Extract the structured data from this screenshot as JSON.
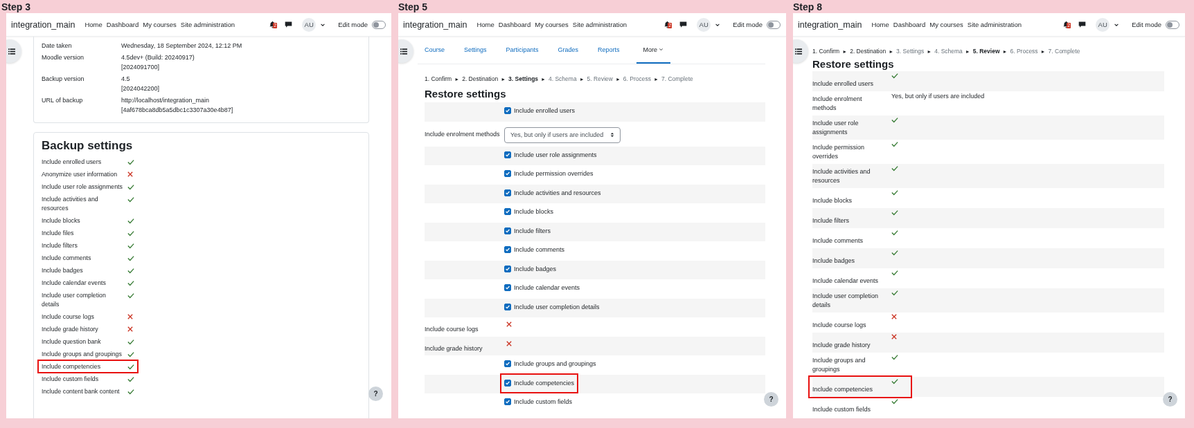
{
  "panels": [
    {
      "step": "Step 3",
      "kind": "backup",
      "site": "integration_main",
      "nav": [
        "Home",
        "Dashboard",
        "My courses",
        "Site administration"
      ],
      "notifications": "2",
      "avatar": "AU",
      "edit_mode_label": "Edit mode",
      "edit_mode": false,
      "help": "?",
      "details": [
        {
          "label": "Date taken",
          "value": [
            "Wednesday, 18 September 2024, 12:12 PM"
          ]
        },
        {
          "label": "Moodle version",
          "value": [
            "4.5dev+ (Build: 20240917)",
            "[2024091700]"
          ]
        },
        {
          "label": "Backup version",
          "value": [
            "4.5",
            "[2024042200]"
          ]
        },
        {
          "label": "URL of backup",
          "value": [
            "http://localhost/integration_main",
            "[4af678bca8db5a5dbc1c3307a30e4b87]"
          ]
        }
      ],
      "title": "Backup settings",
      "rows": [
        {
          "kind": "status",
          "label": "Include enrolled users",
          "included": true,
          "highlighted": false
        },
        {
          "kind": "status",
          "label": "Anonymize user information",
          "included": false,
          "highlighted": false
        },
        {
          "kind": "status",
          "label": "Include user role assignments",
          "included": true,
          "highlighted": false
        },
        {
          "kind": "status",
          "label": "Include activities and resources",
          "included": true,
          "highlighted": false
        },
        {
          "kind": "status",
          "label": "Include blocks",
          "included": true,
          "highlighted": false
        },
        {
          "kind": "status",
          "label": "Include files",
          "included": true,
          "highlighted": false
        },
        {
          "kind": "status",
          "label": "Include filters",
          "included": true,
          "highlighted": false
        },
        {
          "kind": "status",
          "label": "Include comments",
          "included": true,
          "highlighted": false
        },
        {
          "kind": "status",
          "label": "Include badges",
          "included": true,
          "highlighted": false
        },
        {
          "kind": "status",
          "label": "Include calendar events",
          "included": true,
          "highlighted": false
        },
        {
          "kind": "status",
          "label": "Include user completion details",
          "included": true,
          "highlighted": false
        },
        {
          "kind": "status",
          "label": "Include course logs",
          "included": false,
          "highlighted": false
        },
        {
          "kind": "status",
          "label": "Include grade history",
          "included": false,
          "highlighted": false
        },
        {
          "kind": "status",
          "label": "Include question bank",
          "included": true,
          "highlighted": false
        },
        {
          "kind": "status",
          "label": "Include groups and groupings",
          "included": true,
          "highlighted": false
        },
        {
          "kind": "status",
          "label": "Include competencies",
          "included": true,
          "highlighted": true
        },
        {
          "kind": "status",
          "label": "Include custom fields",
          "included": true,
          "highlighted": false
        },
        {
          "kind": "status",
          "label": "Include content bank content",
          "included": true,
          "highlighted": false
        }
      ]
    },
    {
      "step": "Step 5",
      "kind": "restore",
      "site": "integration_main",
      "nav": [
        "Home",
        "Dashboard",
        "My courses",
        "Site administration"
      ],
      "notifications": "2",
      "avatar": "AU",
      "edit_mode_label": "Edit mode",
      "edit_mode": false,
      "help": "?",
      "tabs": [
        {
          "label": "Course",
          "selected": false
        },
        {
          "label": "Settings",
          "selected": false
        },
        {
          "label": "Participants",
          "selected": false
        },
        {
          "label": "Grades",
          "selected": false
        },
        {
          "label": "Reports",
          "selected": false
        },
        {
          "label": "More",
          "selected": true
        }
      ],
      "steps": {
        "separator": "►",
        "items": [
          {
            "label": "1. Confirm",
            "current": false,
            "disabled": false
          },
          {
            "label": "2. Destination",
            "current": false,
            "disabled": false
          },
          {
            "label": "3. Settings",
            "current": true,
            "disabled": false
          },
          {
            "label": "4. Schema",
            "current": false,
            "disabled": true
          },
          {
            "label": "5. Review",
            "current": false,
            "disabled": true
          },
          {
            "label": "6. Process",
            "current": false,
            "disabled": true
          },
          {
            "label": "7. Complete",
            "current": false,
            "disabled": true
          }
        ]
      },
      "title": "Restore settings",
      "rows": [
        {
          "kind": "checkbox",
          "label": "Include enrolled users",
          "checked": true,
          "highlighted": false
        },
        {
          "kind": "select",
          "label": "Include enrolment methods",
          "value": "Yes, but only if users are included",
          "highlighted": false
        },
        {
          "kind": "checkbox",
          "label": "Include user role assignments",
          "checked": true,
          "highlighted": false
        },
        {
          "kind": "checkbox",
          "label": "Include permission overrides",
          "checked": true,
          "highlighted": false
        },
        {
          "kind": "checkbox",
          "label": "Include activities and resources",
          "checked": true,
          "highlighted": false
        },
        {
          "kind": "checkbox",
          "label": "Include blocks",
          "checked": true,
          "highlighted": false
        },
        {
          "kind": "checkbox",
          "label": "Include filters",
          "checked": true,
          "highlighted": false
        },
        {
          "kind": "checkbox",
          "label": "Include comments",
          "checked": true,
          "highlighted": false
        },
        {
          "kind": "checkbox",
          "label": "Include badges",
          "checked": true,
          "highlighted": false
        },
        {
          "kind": "checkbox",
          "label": "Include calendar events",
          "checked": true,
          "highlighted": false
        },
        {
          "kind": "checkbox",
          "label": "Include user completion details",
          "checked": true,
          "highlighted": false
        },
        {
          "kind": "status",
          "label": "Include course logs",
          "included": false,
          "highlighted": false
        },
        {
          "kind": "status",
          "label": "Include grade history",
          "included": false,
          "highlighted": false
        },
        {
          "kind": "checkbox",
          "label": "Include groups and groupings",
          "checked": true,
          "highlighted": false
        },
        {
          "kind": "checkbox",
          "label": "Include competencies",
          "checked": true,
          "highlighted": true
        },
        {
          "kind": "checkbox",
          "label": "Include custom fields",
          "checked": true,
          "highlighted": false
        }
      ]
    },
    {
      "step": "Step 8",
      "kind": "review",
      "site": "integration_main",
      "nav": [
        "Home",
        "Dashboard",
        "My courses",
        "Site administration"
      ],
      "notifications": "2",
      "avatar": "AU",
      "edit_mode_label": "Edit mode",
      "edit_mode": false,
      "help": "?",
      "steps": {
        "separator": "►",
        "items": [
          {
            "label": "1. Confirm",
            "current": false,
            "disabled": false
          },
          {
            "label": "2. Destination",
            "current": false,
            "disabled": false
          },
          {
            "label": "3. Settings",
            "current": false,
            "disabled": true
          },
          {
            "label": "4. Schema",
            "current": false,
            "disabled": true
          },
          {
            "label": "5. Review",
            "current": true,
            "disabled": false
          },
          {
            "label": "6. Process",
            "current": false,
            "disabled": true
          },
          {
            "label": "7. Complete",
            "current": false,
            "disabled": true
          }
        ]
      },
      "title": "Restore settings",
      "rows": [
        {
          "kind": "status",
          "label": "Include enrolled users",
          "included": true,
          "highlighted": false
        },
        {
          "kind": "text",
          "label": "Include enrolment methods",
          "value": "Yes, but only if users are included",
          "highlighted": false
        },
        {
          "kind": "status",
          "label": "Include user role assignments",
          "included": true,
          "highlighted": false
        },
        {
          "kind": "status",
          "label": "Include permission overrides",
          "included": true,
          "highlighted": false
        },
        {
          "kind": "status",
          "label": "Include activities and resources",
          "included": true,
          "highlighted": false
        },
        {
          "kind": "status",
          "label": "Include blocks",
          "included": true,
          "highlighted": false
        },
        {
          "kind": "status",
          "label": "Include filters",
          "included": true,
          "highlighted": false
        },
        {
          "kind": "status",
          "label": "Include comments",
          "included": true,
          "highlighted": false
        },
        {
          "kind": "status",
          "label": "Include badges",
          "included": true,
          "highlighted": false
        },
        {
          "kind": "status",
          "label": "Include calendar events",
          "included": true,
          "highlighted": false
        },
        {
          "kind": "status",
          "label": "Include user completion details",
          "included": true,
          "highlighted": false
        },
        {
          "kind": "status",
          "label": "Include course logs",
          "included": false,
          "highlighted": false
        },
        {
          "kind": "status",
          "label": "Include grade history",
          "included": false,
          "highlighted": false
        },
        {
          "kind": "status",
          "label": "Include groups and groupings",
          "included": true,
          "highlighted": false
        },
        {
          "kind": "status",
          "label": "Include competencies",
          "included": true,
          "highlighted": true
        },
        {
          "kind": "status",
          "label": "Include custom fields",
          "included": true,
          "highlighted": false
        }
      ]
    }
  ]
}
